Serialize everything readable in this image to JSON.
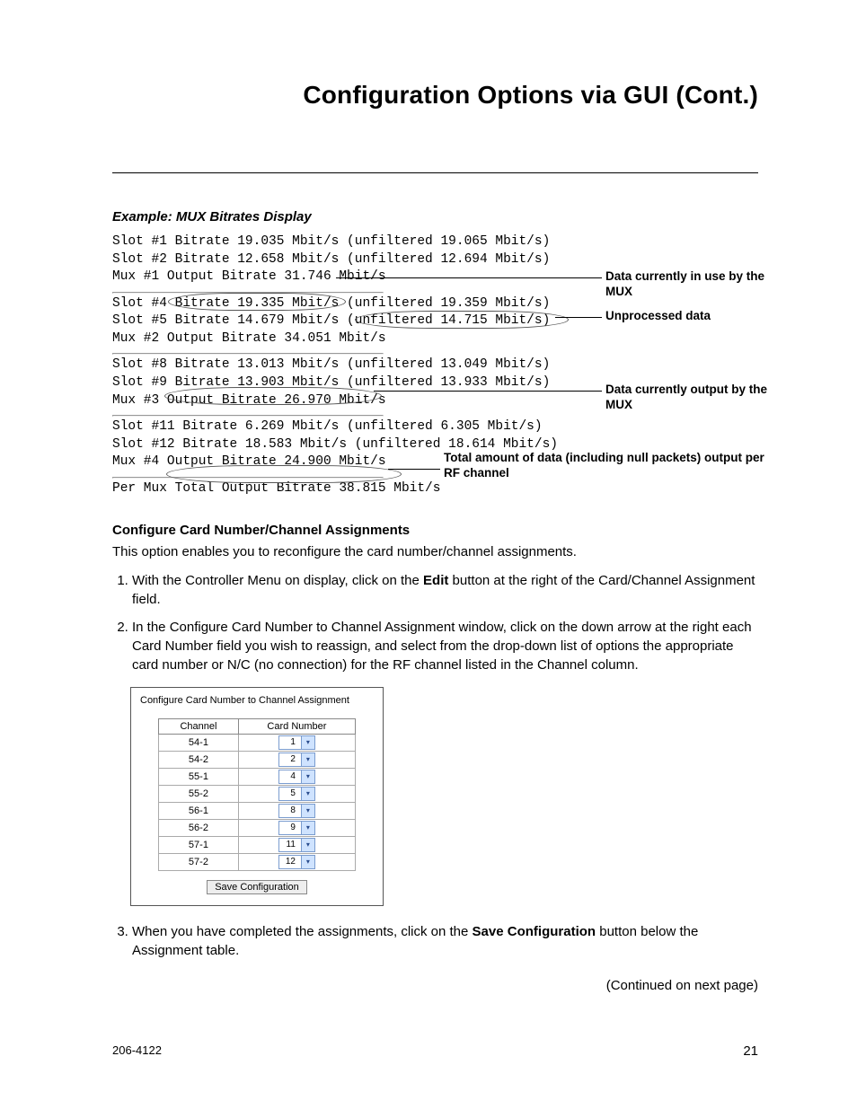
{
  "title": "Configuration Options via GUI (Cont.)",
  "example_caption": "Example: MUX Bitrates Display",
  "mono": {
    "g1_l1": "Slot #1 Bitrate 19.035 Mbit/s (unfiltered 19.065 Mbit/s)",
    "g1_l2": "Slot #2 Bitrate 12.658 Mbit/s (unfiltered 12.694 Mbit/s)",
    "g1_l3": "Mux #1 Output Bitrate 31.746 Mbit/s",
    "g2_l1": "Slot #4 Bitrate 19.335 Mbit/s (unfiltered 19.359 Mbit/s)",
    "g2_l2": "Slot #5 Bitrate 14.679 Mbit/s (unfiltered 14.715 Mbit/s)",
    "g2_l3": "Mux #2 Output Bitrate 34.051 Mbit/s",
    "g3_l1": "Slot #8 Bitrate 13.013 Mbit/s (unfiltered 13.049 Mbit/s)",
    "g3_l2": "Slot #9 Bitrate 13.903 Mbit/s (unfiltered 13.933 Mbit/s)",
    "g3_l3": "Mux #3 Output Bitrate 26.970 Mbit/s",
    "g4_l1": "Slot #11 Bitrate 6.269 Mbit/s (unfiltered 6.305 Mbit/s)",
    "g4_l2": "Slot #12 Bitrate 18.583 Mbit/s (unfiltered 18.614 Mbit/s)",
    "g4_l3": "Mux #4 Output Bitrate 24.900 Mbit/s",
    "total": "Per Mux Total Output Bitrate 38.815 Mbit/s"
  },
  "annotations": {
    "data_in": "Data currently in use by the MUX",
    "unprocessed": "Unprocessed data",
    "data_out": "Data currently output by the MUX",
    "total": "Total amount of data (including null packets) output per RF channel"
  },
  "section_head": "Configure Card Number/Channel Assignments",
  "intro": "This option enables you to reconfigure the card number/channel assignments.",
  "steps": {
    "s1a": "With the Controller Menu on display, click on the ",
    "s1_bold": "Edit",
    "s1b": " button at the right of the Card/Channel Assignment field.",
    "s2": "In the Configure Card Number to Channel Assignment window, click on the down arrow at the right each Card Number field you wish to reassign, and select from the drop-down list of options the appropriate card number or N/C (no connection) for the RF channel listed in the Channel column.",
    "s3a": "When you have completed the assignments, click on the ",
    "s3_bold": "Save Configuration",
    "s3b": " button below the Assignment table."
  },
  "config_box": {
    "title": "Configure Card Number to Channel Assignment",
    "channel_header": "Channel",
    "card_header": "Card Number",
    "rows": [
      {
        "ch": "54-1",
        "card": "1"
      },
      {
        "ch": "54-2",
        "card": "2"
      },
      {
        "ch": "55-1",
        "card": "4"
      },
      {
        "ch": "55-2",
        "card": "5"
      },
      {
        "ch": "56-1",
        "card": "8"
      },
      {
        "ch": "56-2",
        "card": "9"
      },
      {
        "ch": "57-1",
        "card": "11"
      },
      {
        "ch": "57-2",
        "card": "12"
      }
    ],
    "save_label": "Save Configuration"
  },
  "continued": "(Continued on next page)",
  "footer": {
    "docnum": "206-4122",
    "pagenum": "21"
  }
}
